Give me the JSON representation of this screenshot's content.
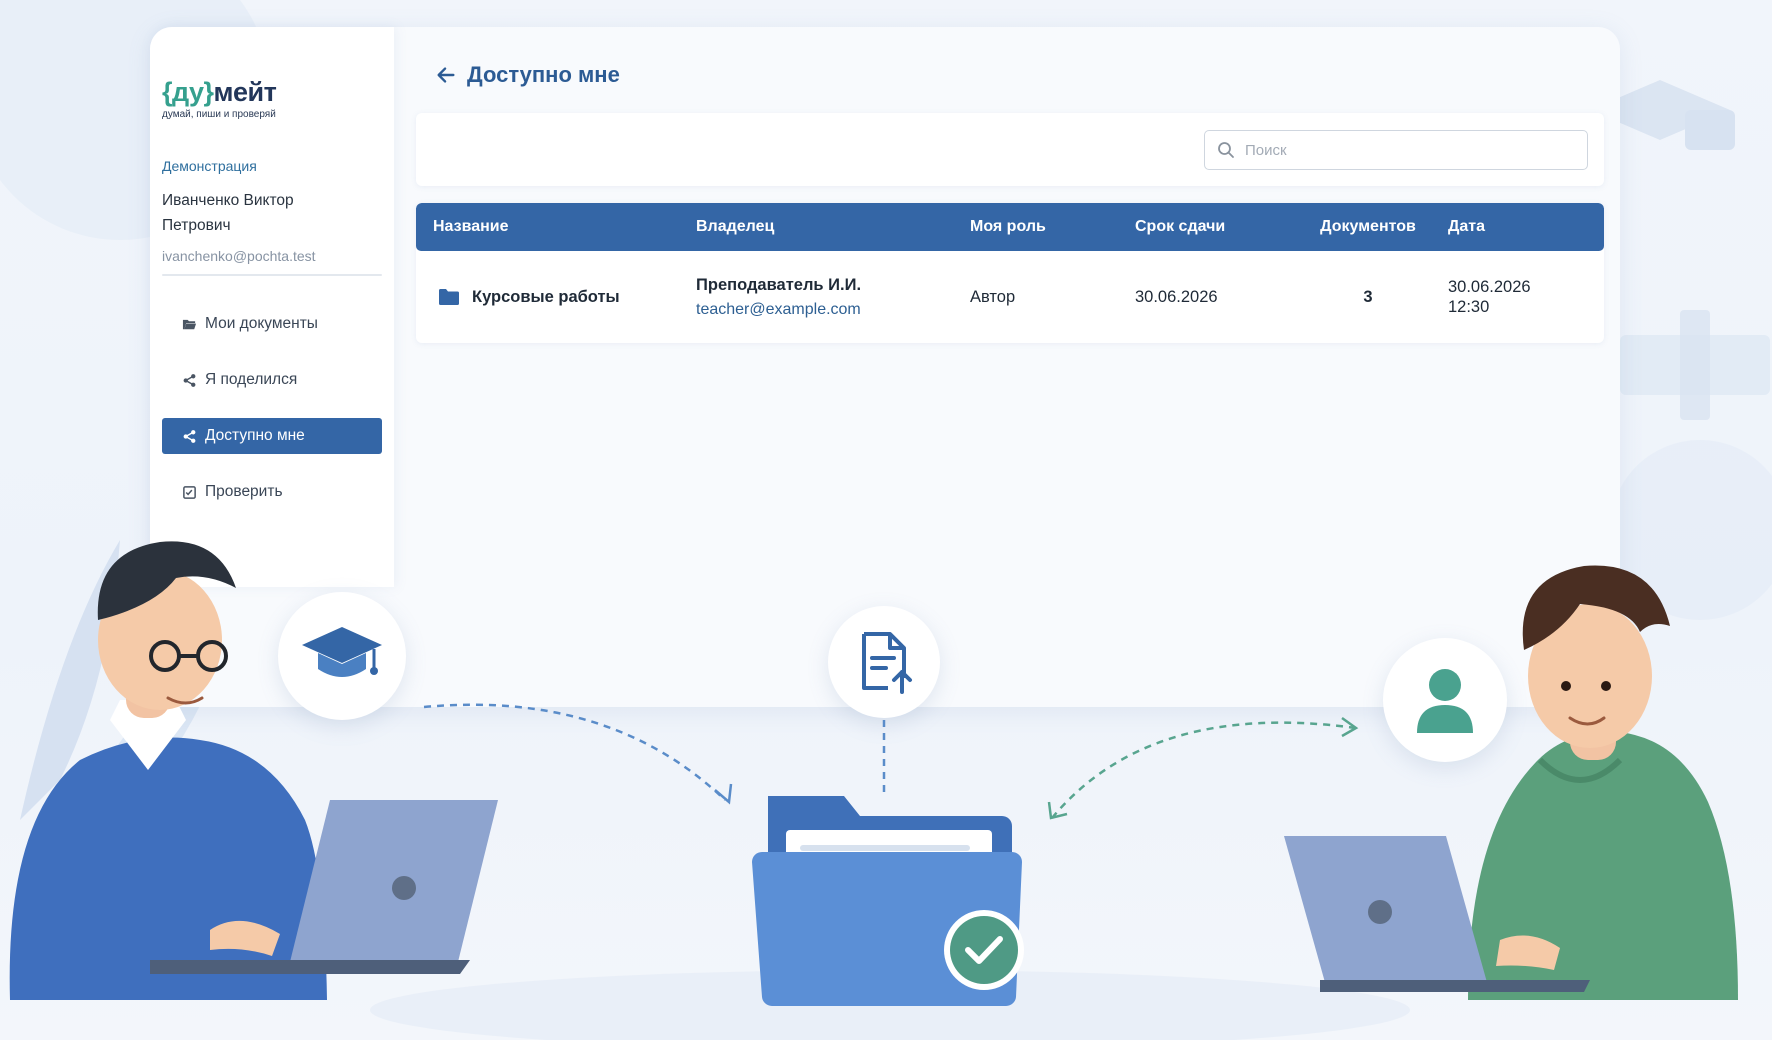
{
  "logo": {
    "brace_open": "{",
    "du": "ду",
    "brace_close": "}",
    "meit": "мейт",
    "tagline": "думай, пиши и проверяй"
  },
  "sidebar": {
    "section": "Демонстрация",
    "user_name_line1": "Иванченко Виктор",
    "user_name_line2": "Петрович",
    "user_email": "ivanchenko@pochta.test",
    "items": [
      {
        "label": "Мои документы",
        "icon": "folder-open-icon",
        "active": false
      },
      {
        "label": "Я поделился",
        "icon": "share-icon",
        "active": false
      },
      {
        "label": "Доступно мне",
        "icon": "share-icon",
        "active": true
      },
      {
        "label": "Проверить",
        "icon": "checklist-icon",
        "active": false
      }
    ]
  },
  "header": {
    "title": "Доступно мне",
    "back_icon": "arrow-left-icon"
  },
  "search": {
    "placeholder": "Поиск",
    "value": ""
  },
  "table": {
    "columns": [
      "Название",
      "Владелец",
      "Моя роль",
      "Срок сдачи",
      "Документов",
      "Дата"
    ],
    "rows": [
      {
        "name": "Курсовые работы",
        "owner_name": "Преподаватель И.И.",
        "owner_email": "teacher@example.com",
        "role": "Автор",
        "deadline": "30.06.2026",
        "documents": "3",
        "date": "30.06.2026",
        "time": "12:30"
      }
    ]
  },
  "colors": {
    "primary": "#3466a6",
    "accent": "#35a08e",
    "link": "#2d5f92"
  },
  "illustration": {
    "icons": [
      "graduation-cap-icon",
      "document-upload-icon",
      "user-icon",
      "folder-check-icon"
    ]
  }
}
